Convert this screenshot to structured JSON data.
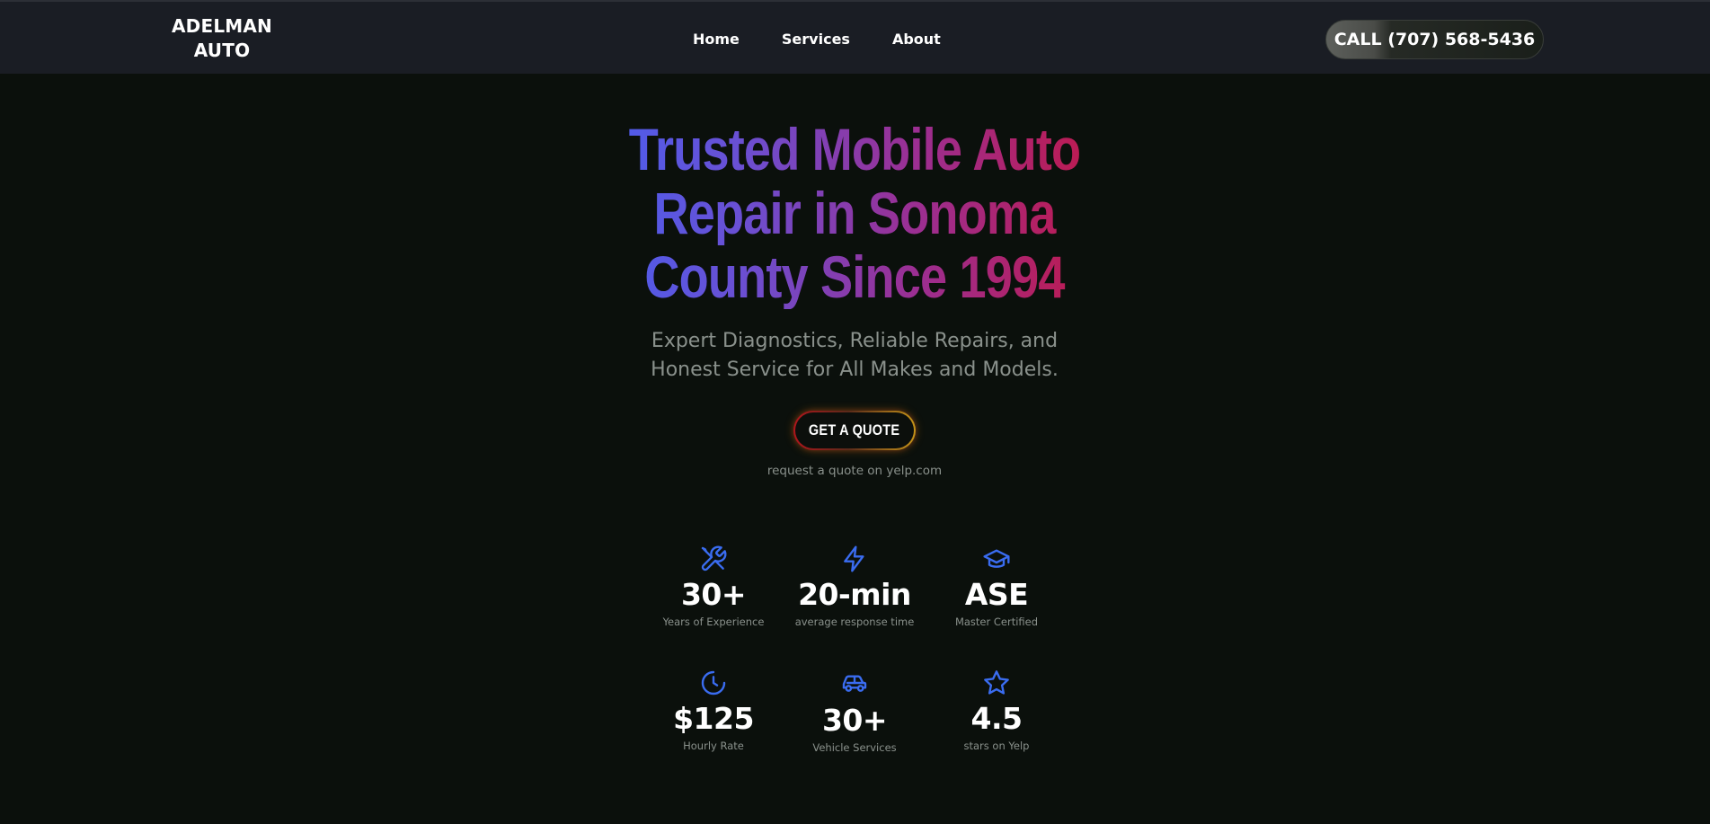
{
  "brand": {
    "logo_line1": "ADELMAN",
    "logo_line2": "AUTO"
  },
  "nav": {
    "links": [
      {
        "label": "Home"
      },
      {
        "label": "Services"
      },
      {
        "label": "About"
      }
    ],
    "call_button": "CALL (707) 568-5436"
  },
  "hero": {
    "title_lines": [
      "Trusted Mobile Auto",
      "Repair in Sonoma",
      "County Since 1994"
    ],
    "subtitle_lines": [
      "Expert Diagnostics, Reliable Repairs, and",
      "Honest Service for All Makes and Models."
    ],
    "cta_button": "GET A QUOTE",
    "cta_note": "request a quote on yelp.com"
  },
  "stats": [
    {
      "icon": "wrench-screwdriver-icon",
      "value": "30+",
      "label": "Years of Experience"
    },
    {
      "icon": "lightning-bolt-icon",
      "value": "20-min",
      "label": "average response time"
    },
    {
      "icon": "graduation-cap-icon",
      "value": "ASE",
      "label": "Master Certified"
    },
    {
      "icon": "clock-icon",
      "value": "$125",
      "label": "Hourly Rate"
    },
    {
      "icon": "car-icon",
      "value": "30+",
      "label": "Vehicle Services"
    },
    {
      "icon": "star-icon",
      "value": "4.5",
      "label": "stars on Yelp"
    }
  ],
  "colors": {
    "background": "#0b100c",
    "navbar": "#1a1d24",
    "accent_blue": "#3a6cf0",
    "gradient_start": "#4362f5",
    "gradient_mid": "#9b2f93",
    "gradient_end": "#c8143a",
    "muted_text": "#8a918c"
  }
}
